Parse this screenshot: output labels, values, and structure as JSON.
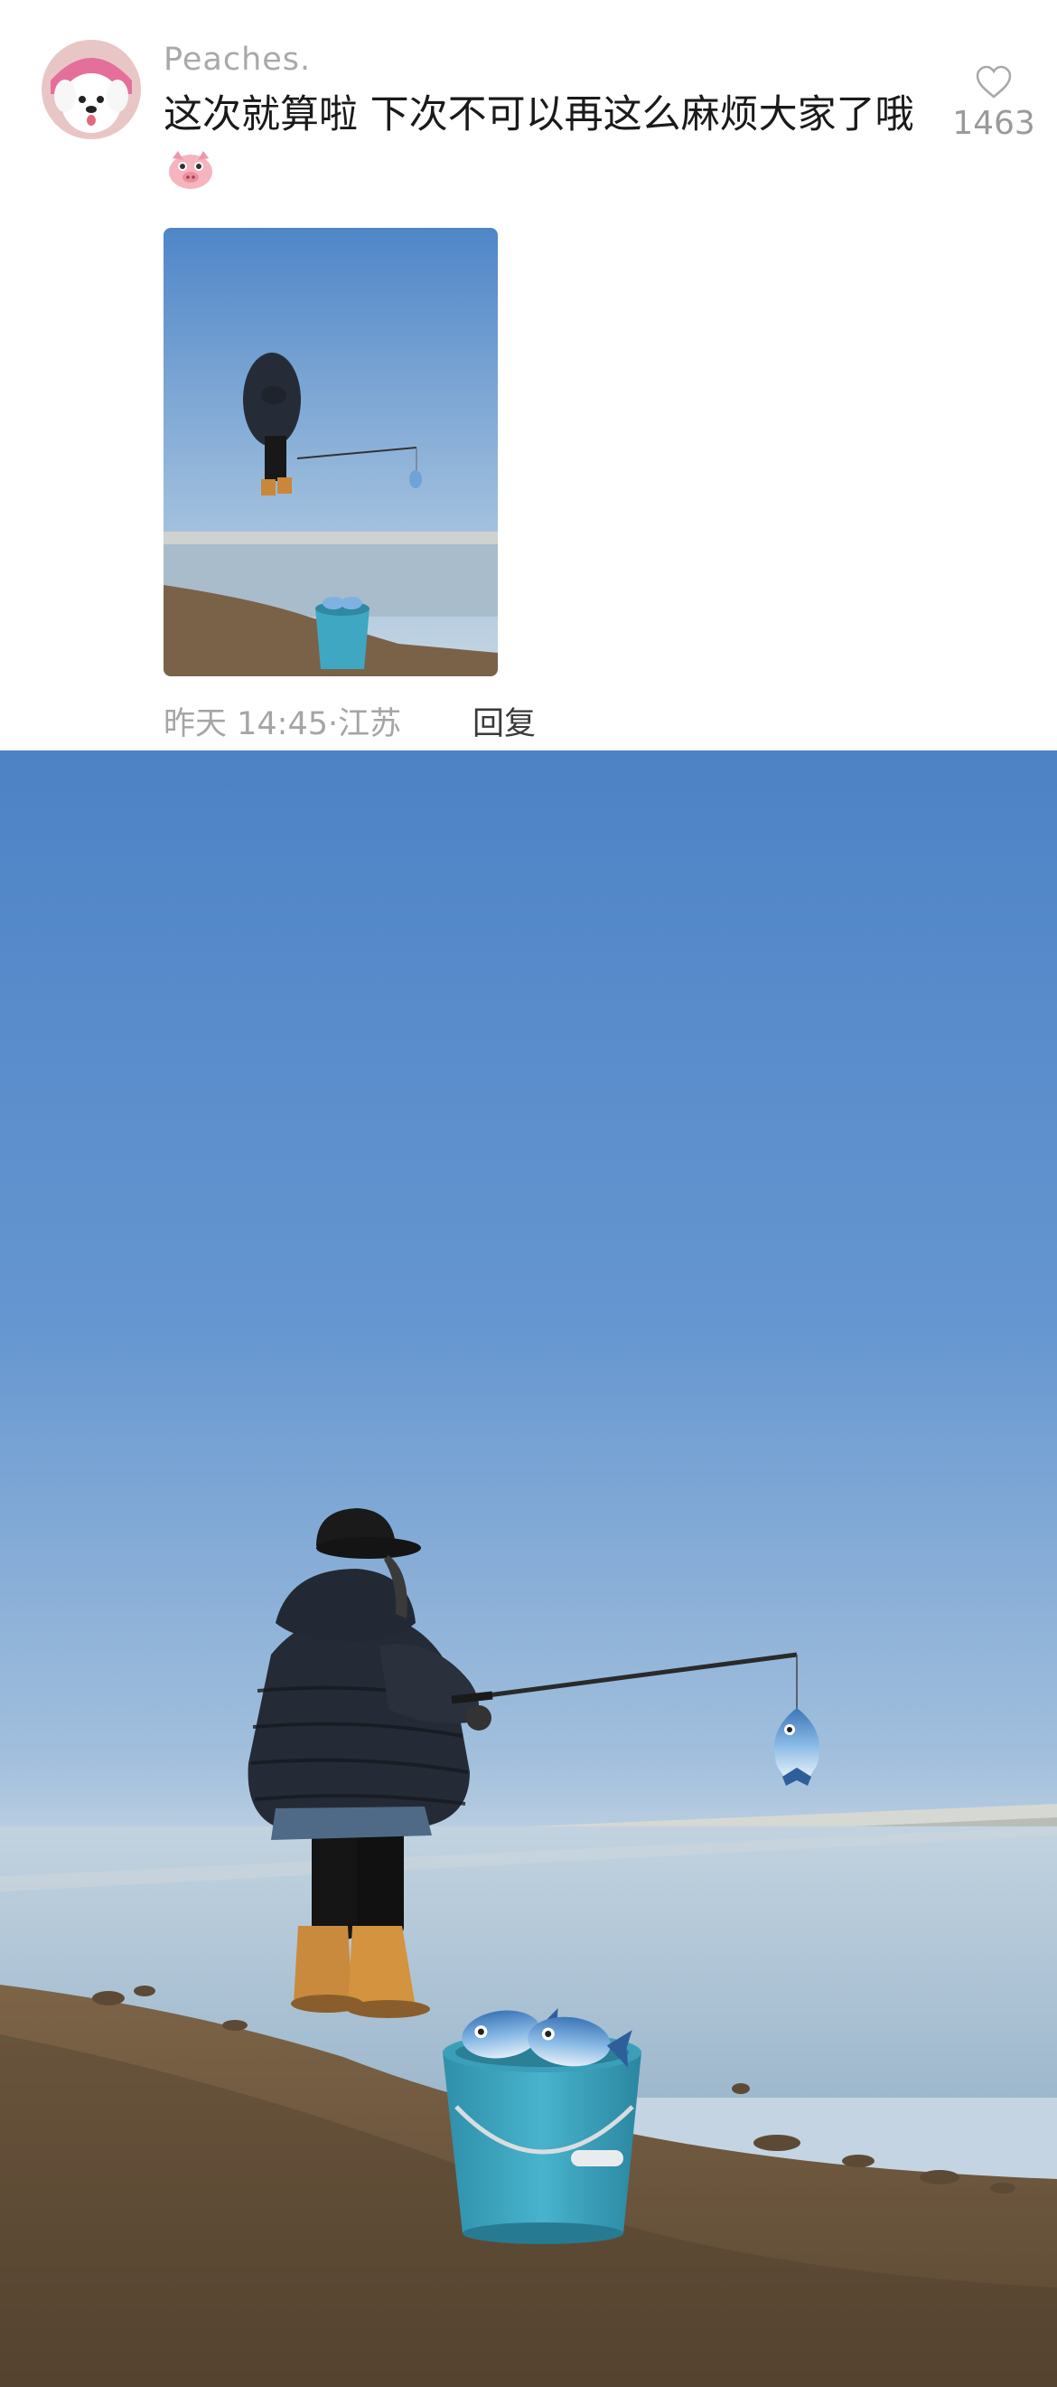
{
  "comment": {
    "username": "Peaches.",
    "text": "这次就算啦 下次不可以再这么麻烦大家了哦",
    "emoji_icon": "pig-face-icon",
    "likes": "1463",
    "timestamp": "昨天 14:45",
    "location": "江苏",
    "reply_label": "回复"
  },
  "icons": {
    "avatar": "white-dog-avatar",
    "like": "heart-outline-icon"
  },
  "colors": {
    "sky_top": "#4f86c8",
    "sky_bottom": "#b9cfe2",
    "bucket": "#3fa7c1",
    "fish": "#6fa3d8"
  }
}
